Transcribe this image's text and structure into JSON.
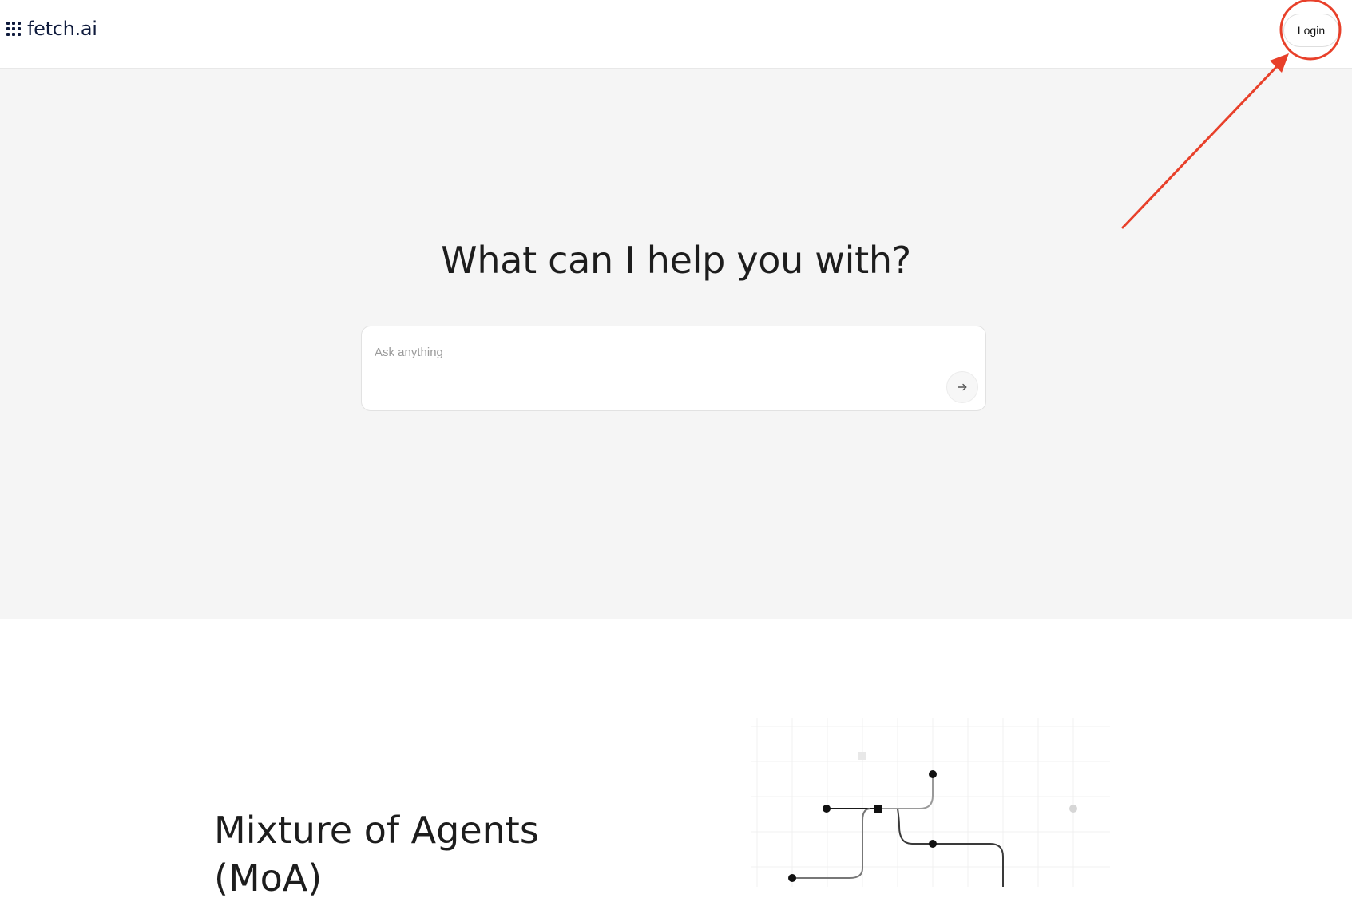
{
  "header": {
    "logo_text": "fetch.ai",
    "login_label": "Login"
  },
  "hero": {
    "title": "What can I help you with?",
    "search_placeholder": "Ask anything"
  },
  "feature": {
    "title": "Mixture of Agents (MoA)"
  },
  "icons": {
    "logo": "fetch-grid-logo-icon",
    "send": "arrow-right-icon"
  },
  "colors": {
    "brand": "#0f1b3d",
    "hero_background": "#f5f5f5",
    "annotation": "#e8402a"
  }
}
